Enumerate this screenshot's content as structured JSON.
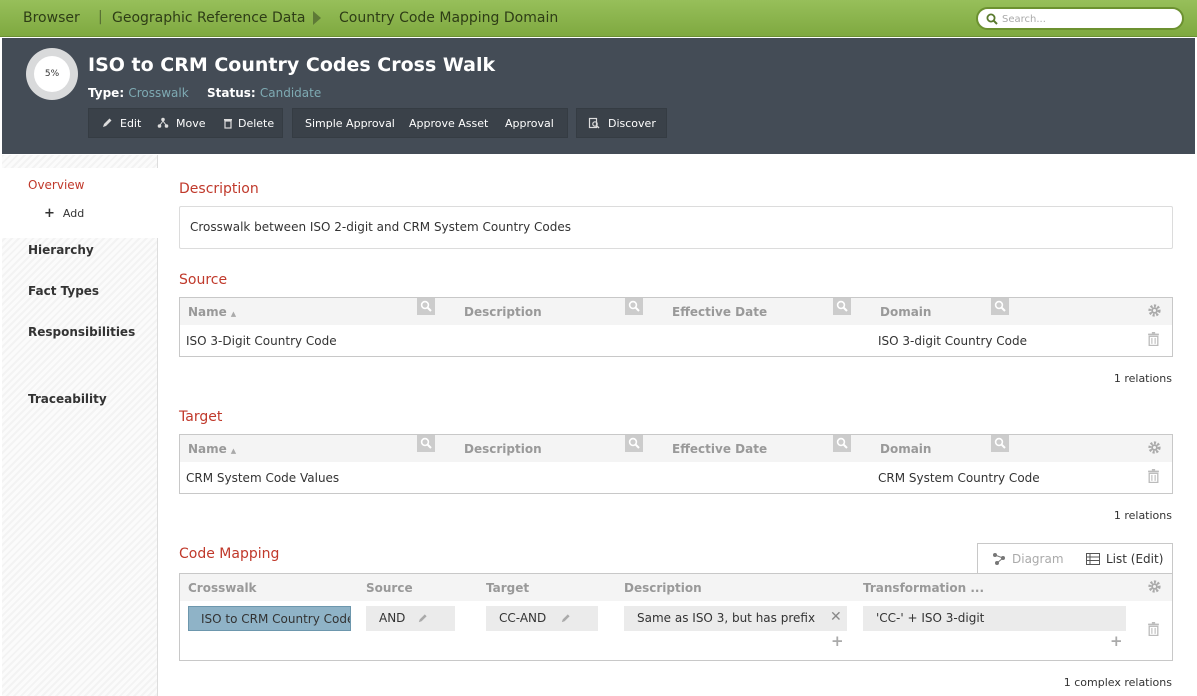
{
  "breadcrumb": {
    "root": "Browser",
    "community": "Geographic Reference Data",
    "domain": "Country Code Mapping Domain"
  },
  "search": {
    "placeholder": "Search..."
  },
  "asset": {
    "progress": "5%",
    "title": "ISO to CRM Country Codes Cross Walk",
    "type_label": "Type:",
    "type_value": "Crosswalk",
    "status_label": "Status:",
    "status_value": "Candidate"
  },
  "toolbar": {
    "edit": "Edit",
    "move": "Move",
    "delete": "Delete",
    "simple_approval": "Simple Approval",
    "approve_asset": "Approve Asset",
    "approval": "Approval",
    "discover": "Discover"
  },
  "sidebar": {
    "overview": "Overview",
    "add": "Add",
    "hierarchy": "Hierarchy",
    "fact_types": "Fact Types",
    "responsibilities": "Responsibilities",
    "traceability": "Traceability"
  },
  "description": {
    "title": "Description",
    "text": "Crosswalk between ISO 2-digit and CRM System Country Codes"
  },
  "source": {
    "title": "Source",
    "columns": [
      "Name",
      "Description",
      "Effective Date",
      "Domain"
    ],
    "row": {
      "name": "ISO 3-Digit Country Code",
      "domain": "ISO 3-digit Country Code"
    },
    "relations": "1 relations"
  },
  "target": {
    "title": "Target",
    "columns": [
      "Name",
      "Description",
      "Effective Date",
      "Domain"
    ],
    "row": {
      "name": "CRM System Code Values",
      "domain": "CRM System Country Code"
    },
    "relations": "1 relations"
  },
  "code_mapping": {
    "title": "Code Mapping",
    "tab_diagram": "Diagram",
    "tab_list": "List (Edit)",
    "columns": [
      "Crosswalk",
      "Source",
      "Target",
      "Description",
      "Transformation ..."
    ],
    "row": {
      "crosswalk": "ISO to CRM Country Codes",
      "source": "AND",
      "target": "CC-AND",
      "description": "Same as ISO 3, but has prefix",
      "transformation": "'CC-' + ISO 3-digit"
    },
    "relations": "1 complex relations"
  },
  "colors": {
    "topbar": "#8bb54d",
    "header": "#444c56",
    "accent_red": "#c0392b",
    "link_teal": "#7eaab3"
  }
}
